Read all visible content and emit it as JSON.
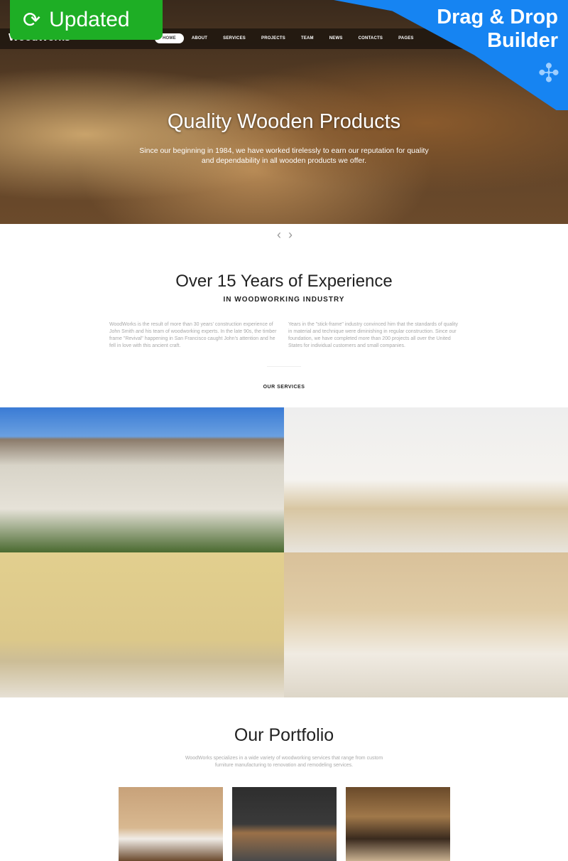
{
  "badges": {
    "updated": "Updated",
    "drag_drop": "Drag & Drop Builder"
  },
  "header": {
    "logo": "WoodWorks",
    "nav": [
      "HOME",
      "ABOUT",
      "SERVICES",
      "PROJECTS",
      "TEAM",
      "NEWS",
      "CONTACTS",
      "PAGES"
    ],
    "active": "HOME"
  },
  "hero": {
    "title": "Quality Wooden Products",
    "text": "Since our beginning in 1984, we have worked tirelessly to earn our reputation for quality and dependability in all wooden products we offer.",
    "prev": "‹",
    "next": "›"
  },
  "experience": {
    "title": "Over 15 Years of Experience",
    "subtitle": "IN WOODWORKING INDUSTRY",
    "col1": "WoodWorks is the result of more than 30 years' construction experience of John Smith and his team of woodworking experts. In the late 90s, the timber frame \"Revival\" happening in San Francisco caught John's attention and he fell in love with this ancient craft.",
    "col2": "Years in the \"stick-frame\" industry convinced him that the standards of quality in material and technique were diminishing in regular construction. Since our foundation, we have completed more than 200 projects all over the United States for individual customers and small companies."
  },
  "services": {
    "title": "OUR SERVICES"
  },
  "portfolio": {
    "title": "Our Portfolio",
    "text": "WoodWorks specializes in a wide variety of woodworking services that range from custom furniture manufacturing to renovation and remodeling services."
  }
}
